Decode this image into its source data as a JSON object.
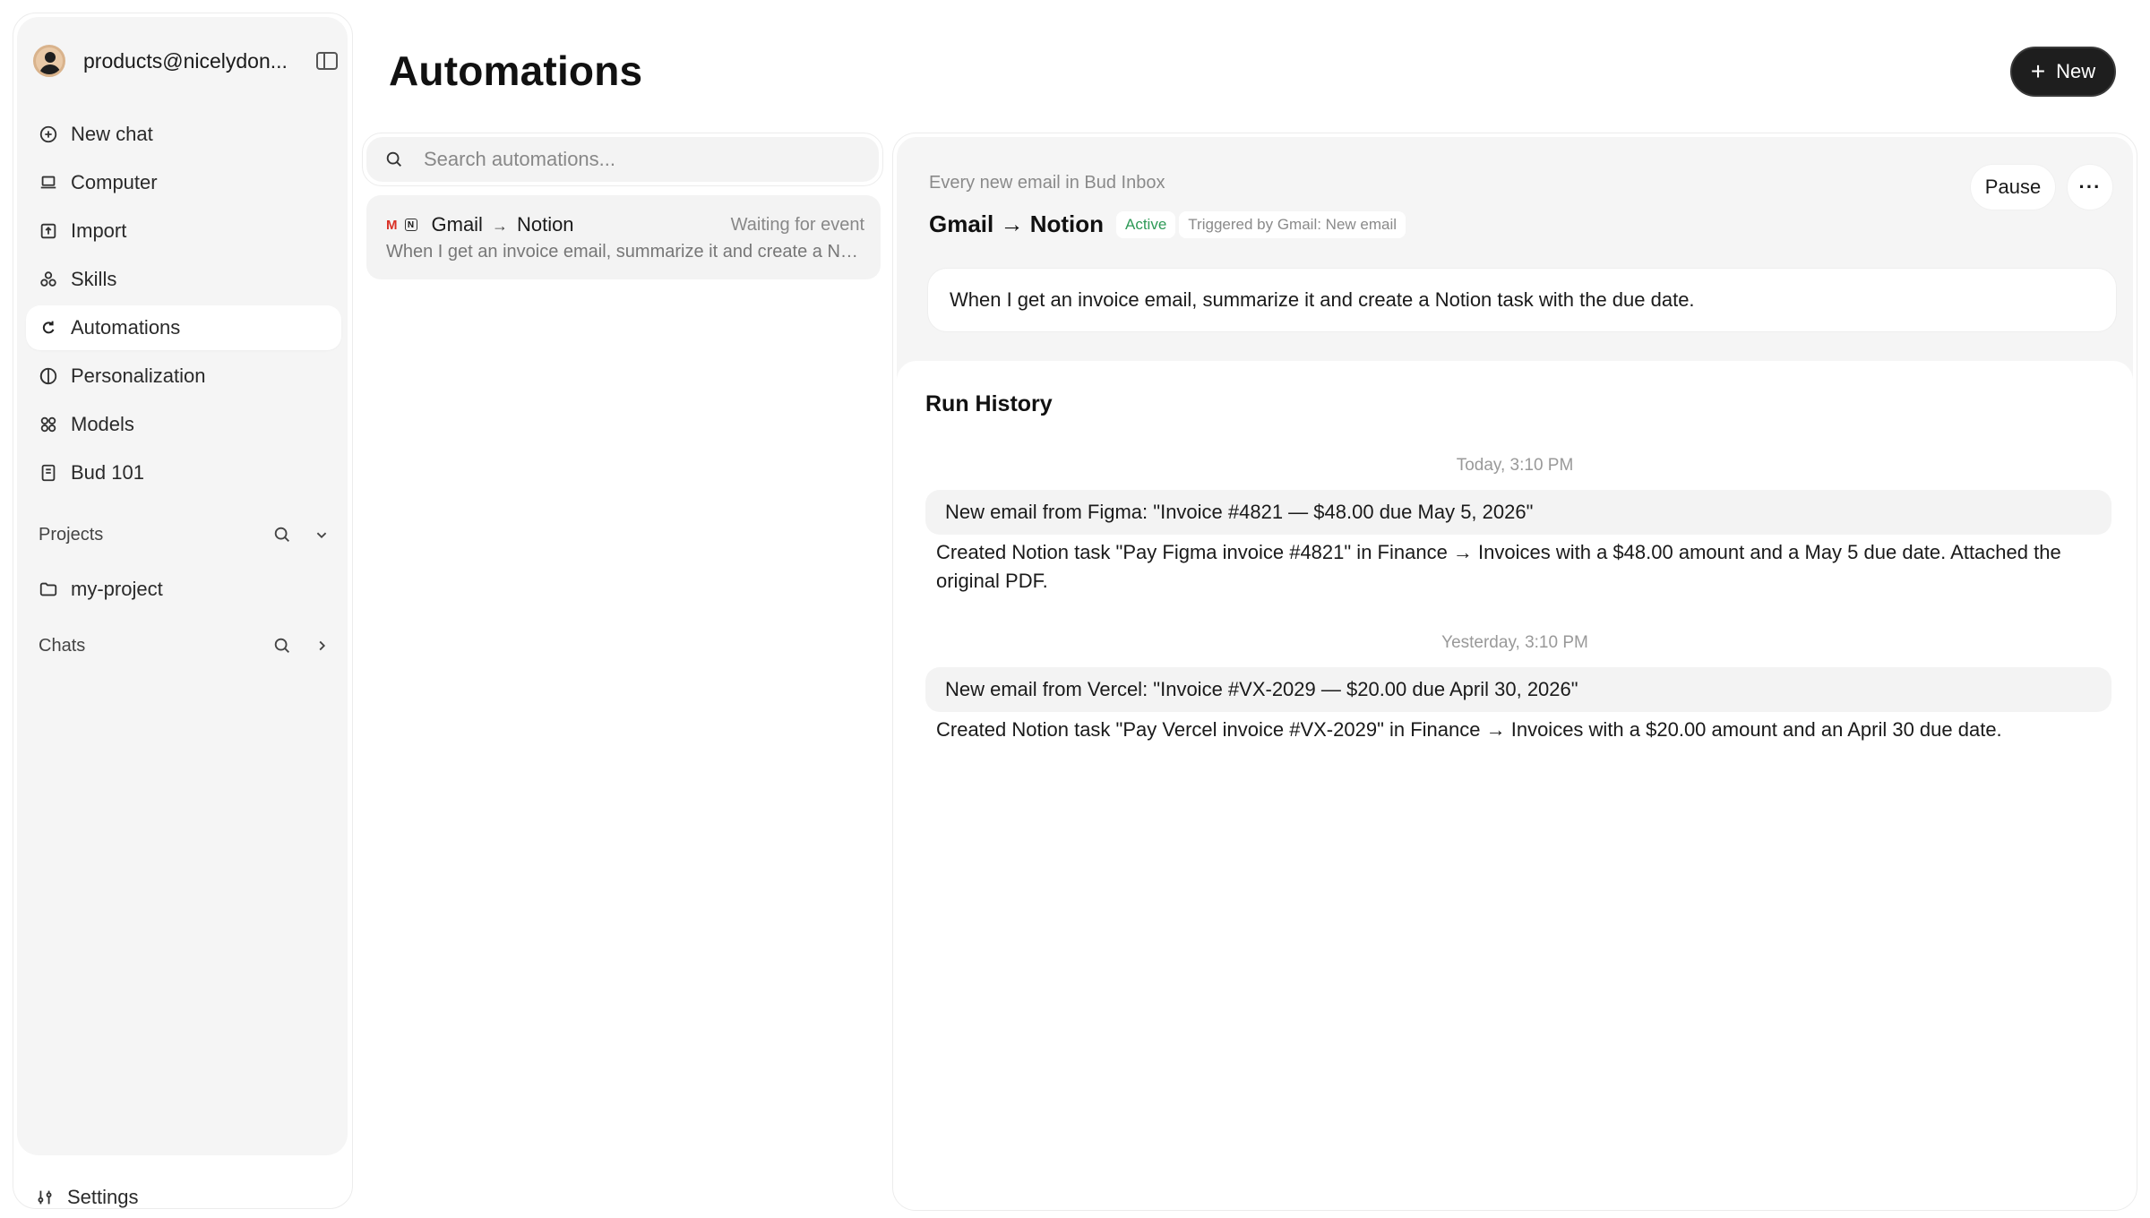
{
  "sidebar": {
    "account_name": "products@nicelydon...",
    "nav": [
      {
        "label": "New chat",
        "icon": "plus-circle-icon"
      },
      {
        "label": "Computer",
        "icon": "laptop-icon"
      },
      {
        "label": "Import",
        "icon": "import-icon"
      },
      {
        "label": "Skills",
        "icon": "shapes-icon"
      },
      {
        "label": "Automations",
        "icon": "loop-icon",
        "active": true
      },
      {
        "label": "Personalization",
        "icon": "globe-half-icon"
      },
      {
        "label": "Models",
        "icon": "models-icon"
      },
      {
        "label": "Bud 101",
        "icon": "book-icon"
      }
    ],
    "projects_label": "Projects",
    "projects": [
      {
        "label": "my-project",
        "icon": "folder-icon"
      }
    ],
    "chats_label": "Chats",
    "settings_label": "Settings"
  },
  "header": {
    "title": "Automations",
    "new_button": "New"
  },
  "list": {
    "search_placeholder": "Search automations...",
    "items": [
      {
        "source": "Gmail",
        "target": "Notion",
        "status": "Waiting for event",
        "description": "When I get an invoice email, summarize it and create a Notion task with the due date."
      }
    ]
  },
  "detail": {
    "trigger_caption": "Every new email in Bud Inbox",
    "title": "Gmail → Notion",
    "status_badge": "Active",
    "trigger_badge": "Triggered by Gmail: New email",
    "pause_button": "Pause",
    "more_button": "···",
    "prompt": "When I get an invoice email, summarize it and create a Notion task with the due date.",
    "history_title": "Run History",
    "runs": [
      {
        "time": "Today, 3:10 PM",
        "trigger": "New email from Figma: \"Invoice #4821 — $48.00 due May 5, 2026\"",
        "result": "Created Notion task \"Pay Figma invoice #4821\" in Finance → Invoices with a $48.00 amount and a May 5 due date. Attached the original PDF."
      },
      {
        "time": "Yesterday, 3:10 PM",
        "trigger": "New email from Vercel: \"Invoice #VX-2029 — $20.00 due April 30, 2026\"",
        "result": "Created Notion task \"Pay Vercel invoice #VX-2029\" in Finance → Invoices with a $20.00 amount and an April 30 due date."
      }
    ]
  },
  "colors": {
    "accent_dark": "#1e1e1e",
    "active_green": "#2e9a57",
    "gmail_red": "#d93025"
  }
}
